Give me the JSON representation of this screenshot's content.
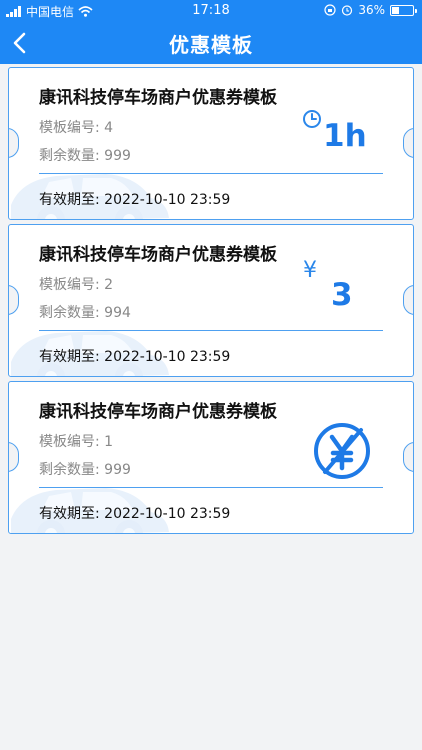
{
  "status": {
    "carrier": "中国电信",
    "time": "17:18",
    "battery": "36%",
    "battery_level": 0.36
  },
  "header": {
    "title": "优惠模板"
  },
  "coupons": [
    {
      "title": "康讯科技停车场商户优惠券模板",
      "template_no": "模板编号: 4",
      "remaining": "剩余数量: 999",
      "valid_until": "有效期至: 2022-10-10 23:59",
      "value": "1h",
      "type_icon": "clock-icon"
    },
    {
      "title": "康讯科技停车场商户优惠券模板",
      "template_no": "模板编号: 2",
      "remaining": "剩余数量: 994",
      "valid_until": "有效期至: 2022-10-10 23:59",
      "currency": "¥",
      "value": "3",
      "type_icon": "yen-icon"
    },
    {
      "title": "康讯科技停车场商户优惠券模板",
      "template_no": "模板编号: 1",
      "remaining": "剩余数量: 999",
      "valid_until": "有效期至: 2022-10-10 23:59",
      "type_icon": "free-yen-icon"
    }
  ],
  "colors": {
    "primary": "#1e88f5",
    "border": "#4ea0f0",
    "background": "#f2f3f5"
  }
}
